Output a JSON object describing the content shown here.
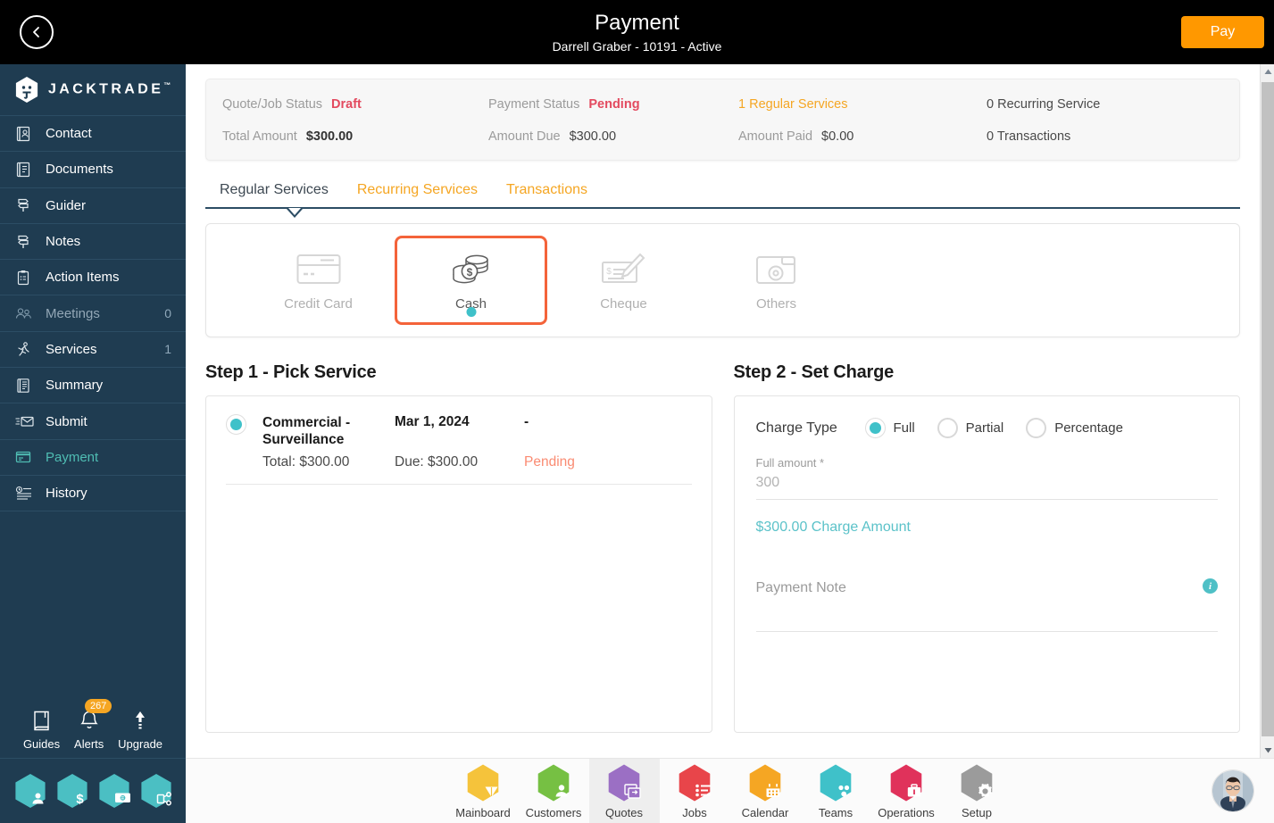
{
  "header": {
    "back_icon": "back-chevron-icon",
    "title": "Payment",
    "subtitle": "Darrell Graber - 10191 - Active",
    "pay_label": "Pay",
    "accent_orange": "#FF9800"
  },
  "sidebar": {
    "brand": "JACKTRADE",
    "brand_tm": "™",
    "items": [
      {
        "label": "Contact",
        "icon": "contact-card-icon",
        "count": ""
      },
      {
        "label": "Documents",
        "icon": "document-icon",
        "count": ""
      },
      {
        "label": "Guider",
        "icon": "signpost-icon",
        "count": ""
      },
      {
        "label": "Notes",
        "icon": "signpost-icon",
        "count": ""
      },
      {
        "label": "Action Items",
        "icon": "clipboard-icon",
        "count": ""
      },
      {
        "label": "Meetings",
        "icon": "meeting-icon",
        "count": "0"
      },
      {
        "label": "Services",
        "icon": "service-worker-icon",
        "count": "1"
      },
      {
        "label": "Summary",
        "icon": "summary-book-icon",
        "count": ""
      },
      {
        "label": "Submit",
        "icon": "submit-envelope-icon",
        "count": ""
      },
      {
        "label": "Payment",
        "icon": "payment-card-icon",
        "count": ""
      },
      {
        "label": "History",
        "icon": "history-list-icon",
        "count": ""
      }
    ],
    "active_item": "Payment",
    "tools": [
      {
        "label": "Guides",
        "icon": "book-icon",
        "badge": ""
      },
      {
        "label": "Alerts",
        "icon": "bell-icon",
        "badge": "267"
      },
      {
        "label": "Upgrade",
        "icon": "arrow-up-icon",
        "badge": ""
      }
    ],
    "quick_hex": [
      {
        "icon": "person-icon"
      },
      {
        "icon": "dollar-icon"
      },
      {
        "icon": "money-transfer-icon"
      },
      {
        "icon": "workflow-icon"
      }
    ],
    "active_color": "#4FBDB3",
    "background": "#1F3C51"
  },
  "summary": {
    "row1": [
      {
        "label": "Quote/Job Status",
        "value": "Draft",
        "style": "draft"
      },
      {
        "label": "Payment Status",
        "value": "Pending",
        "style": "pending"
      },
      {
        "label": "",
        "value": "1 Regular Services",
        "style": "link"
      },
      {
        "label": "",
        "value": "0 Recurring Service",
        "style": "plain"
      }
    ],
    "row2": [
      {
        "label": "Total Amount",
        "value": "$300.00",
        "style": "bold"
      },
      {
        "label": "Amount Due",
        "value": "$300.00",
        "style": "normal"
      },
      {
        "label": "Amount Paid",
        "value": "$0.00",
        "style": "normal"
      },
      {
        "label": "",
        "value": "0 Transactions",
        "style": "plain"
      }
    ]
  },
  "tabs": [
    {
      "label": "Regular Services",
      "active": true
    },
    {
      "label": "Recurring Services",
      "active": false
    },
    {
      "label": "Transactions",
      "active": false
    }
  ],
  "payment_methods": {
    "selected": "Cash",
    "selected_border": "#F4633A",
    "selected_dot": "#3FC1C9",
    "items": [
      {
        "label": "Credit Card",
        "icon": "credit-card-icon",
        "selected": false
      },
      {
        "label": "Cash",
        "icon": "coins-cash-icon",
        "selected": true
      },
      {
        "label": "Cheque",
        "icon": "cheque-pen-icon",
        "selected": false
      },
      {
        "label": "Others",
        "icon": "wallet-gear-icon",
        "selected": false
      }
    ]
  },
  "step1": {
    "title": "Step 1 - Pick Service",
    "service": {
      "selected": true,
      "name": "Commercial - Surveillance",
      "date": "Mar 1, 2024",
      "third": "-",
      "total": "Total: $300.00",
      "due": "Due: $300.00",
      "status": "Pending",
      "status_color": "#FA8B72"
    }
  },
  "step2": {
    "title": "Step 2 - Set Charge",
    "charge_type_label": "Charge Type",
    "charge_types": [
      {
        "label": "Full",
        "selected": true
      },
      {
        "label": "Partial",
        "selected": false
      },
      {
        "label": "Percentage",
        "selected": false
      }
    ],
    "amount_field": {
      "label": "Full amount *",
      "value": "300",
      "placeholder": "300"
    },
    "charge_amount_text": "$300.00 Charge Amount",
    "charge_amount_color": "#5BC2C9",
    "note_field": {
      "label": "Payment Note",
      "value": "",
      "placeholder": "Payment Note",
      "info_icon": "info-icon"
    }
  },
  "bottom_nav": {
    "selected": "Quotes",
    "items": [
      {
        "label": "Mainboard",
        "icon": "mainboard-icon",
        "color": "#F5C councils"
      },
      {
        "label": "Customers",
        "icon": "customers-icon",
        "color": "#76C043"
      },
      {
        "label": "Quotes",
        "icon": "quotes-icon",
        "color": "#9B6FC4"
      },
      {
        "label": "Jobs",
        "icon": "jobs-icon",
        "color": "#E8454A"
      },
      {
        "label": "Calendar",
        "icon": "calendar-icon",
        "color": "#F5A623"
      },
      {
        "label": "Teams",
        "icon": "teams-icon",
        "color": "#3FC1C9"
      },
      {
        "label": "Operations",
        "icon": "operations-icon",
        "color": "#E0325B"
      },
      {
        "label": "Setup",
        "icon": "setup-gear-icon",
        "color": "#9B9B9B"
      }
    ],
    "avatar": "user-avatar"
  },
  "scrollbar": {
    "up_icon": "scroll-up-arrow-icon",
    "down_icon": "scroll-down-arrow-icon"
  }
}
